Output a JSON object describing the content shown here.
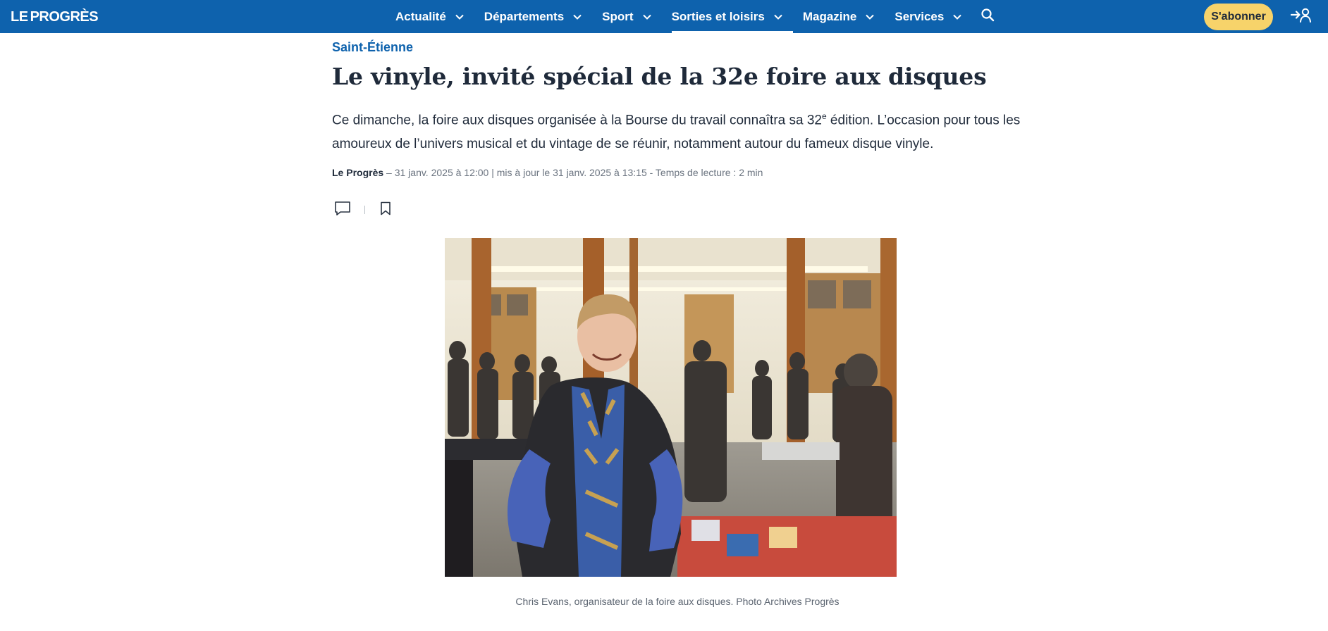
{
  "header": {
    "logo_le": "LE",
    "logo_name": "PROGRÈS",
    "nav": [
      {
        "label": "Actualité"
      },
      {
        "label": "Départements"
      },
      {
        "label": "Sport"
      },
      {
        "label": "Sorties et loisirs",
        "active": true
      },
      {
        "label": "Magazine"
      },
      {
        "label": "Services"
      }
    ],
    "search_icon": "search-icon",
    "subscribe_label": "S'abonner",
    "login_icon": "login-icon"
  },
  "article": {
    "rubric": "Saint-Étienne",
    "title": "Le vinyle, invité spécial de la 32e foire aux disques",
    "chapo_before_sup": "Ce dimanche, la foire aux disques organisée à la Bourse du travail connaîtra sa 32",
    "chapo_sup": "e",
    "chapo_after_sup": " édition. L’occasion pour tous les amoureux de l’univers musical et du vintage de se réunir, notamment autour du fameux disque vinyle.",
    "author": "Le Progrès",
    "meta_rest": " – 31 janv. 2025 à 12:00 | mis à jour le 31 janv. 2025 à 13:15 - Temps de lecture : 2 min",
    "comment_icon": "comment-icon",
    "bookmark_icon": "bookmark-icon",
    "caption": "Chris Evans, organisateur de la foire aux disques.  Photo Archives Progrès"
  },
  "colors": {
    "brand_blue": "#0e62ad",
    "subscribe_yellow": "#f7d36a",
    "text_dark": "#1f2a3a"
  }
}
